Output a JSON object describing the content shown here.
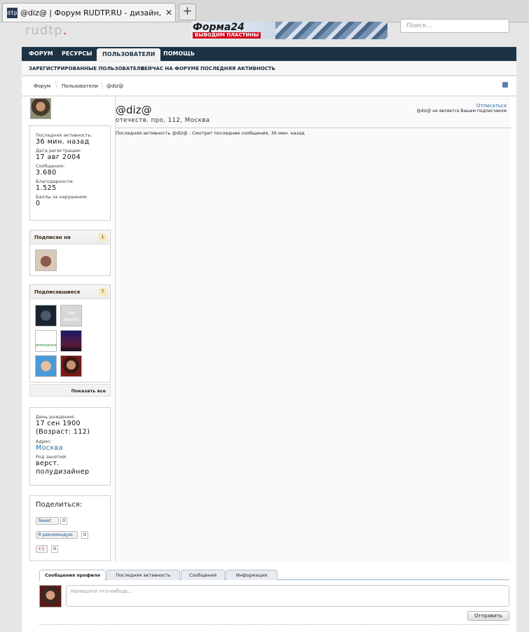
{
  "browser": {
    "tab_title": "@diz@ | Форум RUDTP.RU - дизайн, ве...",
    "favicon_text": "dtp",
    "close_glyph": "✕",
    "newtab_glyph": "+"
  },
  "site": {
    "logo_main": "rudtp",
    "logo_accent": ".",
    "banner_title": "Форма24",
    "banner_sub": "ВЫВОДИМ ПЛАСТИНЫ",
    "search_placeholder": "Поиск..."
  },
  "nav": {
    "items": [
      "ФОРУМ",
      "РЕСУРСЫ",
      "ПОЛЬЗОВАТЕЛИ",
      "ПОМОЩЬ"
    ],
    "subitems": [
      "ЗАРЕГИСТРИРОВАННЫЕ ПОЛЬЗОВАТЕЛИ",
      "СЕЙЧАС НА ФОРУМЕ",
      "ПОСЛЕДНЯЯ АКТИВНОСТЬ"
    ]
  },
  "breadcrumb": [
    "Форум",
    "Пользователи",
    "@diz@"
  ],
  "stats": {
    "last_activity_label": "Последняя активность:",
    "last_activity_value": "36 мин. назад",
    "registered_label": "Дата регистрации:",
    "registered_value": "17 авг 2004",
    "messages_label": "Сообщения:",
    "messages_value": "3.680",
    "likes_label": "Благодарности:",
    "likes_value": "1.525",
    "points_label": "Баллы за нарушения:",
    "points_value": "0"
  },
  "following": {
    "title": "Подписан на",
    "count": "1"
  },
  "followers": {
    "title": "Подписавшиеся",
    "count": "7",
    "noavatar_text": "No avatar",
    "greenpeace_text": "greenpeace",
    "show_all": "Показать все"
  },
  "info": {
    "birthday_label": "День рождения:",
    "birthday_value": "17 сен 1900",
    "age_value": "(Возраст: 112)",
    "address_label": "Адрес:",
    "address_value": "Москва",
    "occupation_label": "Род занятий:",
    "occupation_value": "верст. полудизайнер"
  },
  "share": {
    "title": "Поделиться:",
    "tweet": "Tweet",
    "tweet_count": "0",
    "fb": "Я рекомендую",
    "fb_count": "0",
    "gplus": "+1",
    "gplus_count": "0"
  },
  "profile": {
    "name": "@diz@",
    "subtitle": "отечеств. про, 112, Москва",
    "unfollow": "Отписаться",
    "ignore_note": "@diz@ не является Вашим подписчиком",
    "activity": "Последняя активность @diz@ : Смотрит последние сообщения, 36 мин. назад"
  },
  "tabs": [
    "Сообщения профиля",
    "Последняя активность",
    "Сообщения",
    "Информация"
  ],
  "post": {
    "placeholder": "Напишите что-нибудь...",
    "send": "Отправить"
  }
}
